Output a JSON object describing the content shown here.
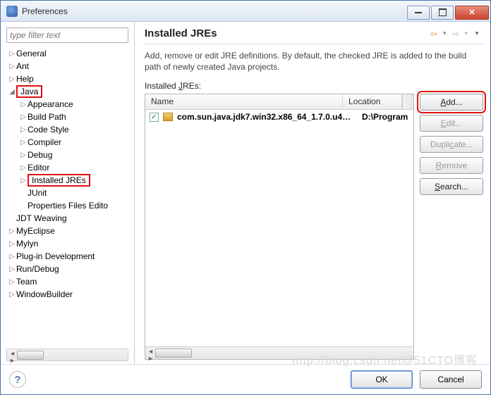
{
  "title": "Preferences",
  "filter_placeholder": "type filter text",
  "tree": {
    "general": "General",
    "ant": "Ant",
    "help": "Help",
    "java": "Java",
    "appearance": "Appearance",
    "build_path": "Build Path",
    "code_style": "Code Style",
    "compiler": "Compiler",
    "debug": "Debug",
    "editor": "Editor",
    "installed_jres": "Installed JREs",
    "junit": "JUnit",
    "properties_files_editor": "Properties Files Edito",
    "jdt_weaving": "JDT Weaving",
    "myeclipse": "MyEclipse",
    "mylyn": "Mylyn",
    "plugin_dev": "Plug-in Development",
    "run_debug": "Run/Debug",
    "team": "Team",
    "window_builder": "WindowBuilder"
  },
  "page": {
    "title": "Installed JREs",
    "description": "Add, remove or edit JRE definitions. By default, the checked JRE is added to the build path of newly created Java projects.",
    "list_label_pre": "Installed ",
    "list_label_mn": "J",
    "list_label_post": "REs:",
    "columns": {
      "name": "Name",
      "location": "Location"
    },
    "row": {
      "name": "com.sun.java.jdk7.win32.x86_64_1.7.0.u4…",
      "location": "D:\\Program"
    },
    "buttons": {
      "add_mn": "A",
      "add_post": "dd...",
      "edit_mn": "E",
      "edit_post": "dit...",
      "dup_pre": "Dupli",
      "dup_mn": "c",
      "dup_post": "ate...",
      "remove_mn": "R",
      "remove_post": "emove",
      "search_mn": "S",
      "search_post": "earch..."
    }
  },
  "footer": {
    "ok": "OK",
    "cancel": "Cancel"
  },
  "watermark": "http://blog.csdn.net@51CTO博客"
}
